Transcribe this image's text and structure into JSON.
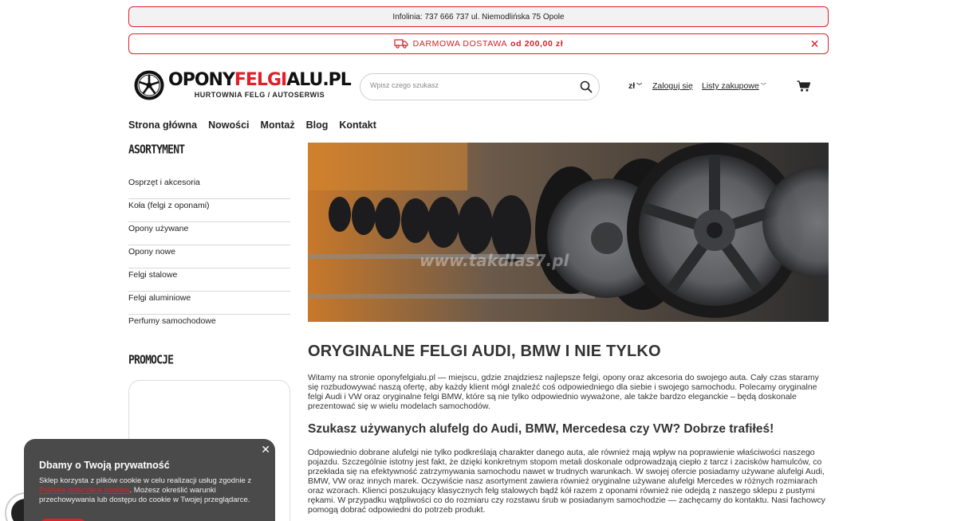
{
  "topbar": {
    "info": "Infolinia: 737 666 737 ul. Niemodlińska 75 Opole",
    "shipping_prefix": "DARMOWA DOSTAWA",
    "shipping_amount": "od 200,00 zł",
    "close": "✕"
  },
  "header": {
    "logo_brand_a": "OPONY",
    "logo_brand_b": "FELGI",
    "logo_brand_c": "ALU.PL",
    "logo_tagline": "HURTOWNIA FELG / AUTOSERWIS",
    "search_placeholder": "Wpisz czego szukasz",
    "currency": "zł",
    "login": "Zaloguj się",
    "lists": "Listy zakupowe"
  },
  "nav": [
    "Strona główna",
    "Nowości",
    "Montaż",
    "Blog",
    "Kontakt"
  ],
  "sidebar": {
    "heading": "ASORTYMENT",
    "categories": [
      "Osprzęt i akcesoria",
      "Koła (felgi z oponami)",
      "Opony używane",
      "Opony nowe",
      "Felgi stalowe",
      "Felgi aluminiowe",
      "Perfumy samochodowe"
    ],
    "promo_heading": "PROMOCJE"
  },
  "hero": {
    "watermark": "www.takdlas7.pl"
  },
  "content": {
    "h1": "ORYGINALNE FELGI AUDI, BMW I NIE TYLKO",
    "p1": "Witamy na stronie oponyfelgialu.pl — miejscu, gdzie znajdziesz najlepsze felgi, opony oraz akcesoria do swojego auta. Cały czas staramy się rozbudowywać naszą ofertę, aby każdy klient mógł znaleźć coś odpowiedniego dla siebie i swojego samochodu. Polecamy oryginalne felgi Audi i VW oraz oryginalne felgi BMW, które są nie tylko odpowiednio wyważone, ale także bardzo eleganckie – będą doskonale prezentować się w wielu modelach samochodów.",
    "h2": "Szukasz używanych alufelg do Audi, BMW, Mercedesa czy VW? Dobrze trafiłeś!",
    "p2": "Odpowiednio dobrane alufelgi nie tylko podkreślają charakter danego auta, ale również mają wpływ na poprawienie właściwości naszego pojazdu. Szczególnie istotny jest fakt, że dzięki konkretnym stopom metali doskonale odprowadzają ciepło z tarcz i zacisków hamulców, co przekłada się na efektywność zatrzymywania samochodu nawet w trudnych warunkach. W swojej ofercie posiadamy używane alufelgi Audi, BMW, VW oraz innych marek. Oczywiście nasz asortyment zawiera również oryginalne używane alufelgi Mercedes w różnych rozmiarach oraz wzorach. Klienci poszukujący klasycznych felg stalowych bądź kół razem z oponami również nie odejdą z naszego sklepu z pustymi rękami. W przypadku wątpliwości co do rozmiaru czy rozstawu śrub w posiadanym samochodzie — zachęcamy do kontaktu. Nasi fachowcy pomogą dobrać odpowiedni do potrzeb produkt."
  },
  "cookie": {
    "title": "Dbamy o Twoją prywatność",
    "text_a": "Sklep korzysta z plików cookie w celu realizacji usług zgodnie z ",
    "link": "Polityką dotyczącą cookies",
    "text_b": ". Możesz określić warunki przechowywania lub dostępu do cookie w Twojej przeglądarce.",
    "close": "✕"
  },
  "colors": {
    "accent": "#e0202a",
    "cookie_bg": "#4a4a4a",
    "info_bg": "#f2f2f2"
  }
}
